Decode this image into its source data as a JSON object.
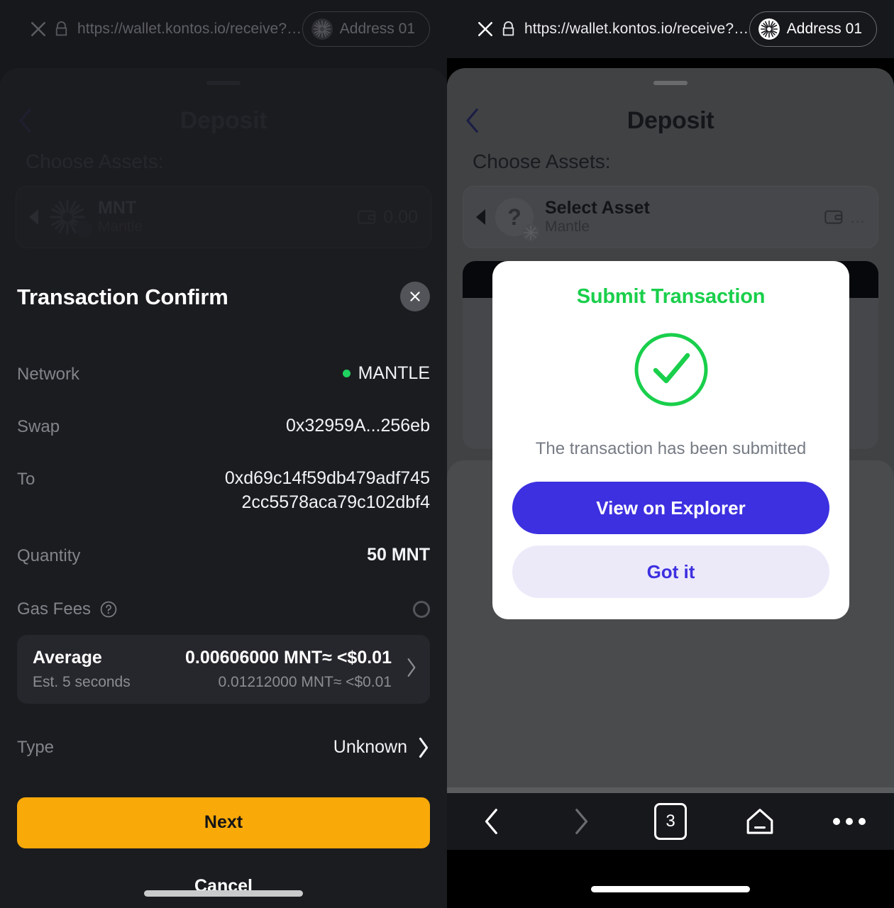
{
  "browser": {
    "url": "https://wallet.kontos.io/receive?cha...",
    "address_pill": "Address 01",
    "close_icon": "close-icon",
    "lock_icon": "lock-icon"
  },
  "left_panel": {
    "background_page": {
      "title": "Deposit",
      "choose_assets_label": "Choose Assets:",
      "asset": {
        "symbol": "MNT",
        "chain": "Mantle",
        "balance": "0.00"
      }
    },
    "confirm_sheet": {
      "title": "Transaction Confirm",
      "close_icon": "close-icon",
      "rows": [
        {
          "key": "Network",
          "value": "MANTLE",
          "status_color": "#1fd360"
        },
        {
          "key": "Swap",
          "value": "0x32959A...256eb"
        },
        {
          "key": "To",
          "value": "0xd69c14f59db479adf7452cc5578aca79c102dbf4"
        },
        {
          "key": "Quantity",
          "value": "50 MNT"
        }
      ],
      "gas": {
        "label": "Gas Fees",
        "help_icon": "question-mark-icon",
        "loading_icon": "spinner-icon",
        "tier": "Average",
        "amount": "0.00606000 MNT≈ <$0.01",
        "eta": "Est. 5 seconds",
        "amount_alt": "0.01212000 MNT≈ <$0.01",
        "chevron_icon": "chevron-right-icon"
      },
      "type_row": {
        "key": "Type",
        "value": "Unknown",
        "chevron_icon": "chevron-right-icon"
      },
      "next_label": "Next",
      "cancel_label": "Cancel",
      "next_color": "#f9a908"
    }
  },
  "right_panel": {
    "background_page": {
      "title": "Deposit",
      "choose_assets_label": "Choose Assets:",
      "asset": {
        "symbol": "Select Asset",
        "chain": "Mantle",
        "balance": "...",
        "avatar_glyph": "?"
      }
    },
    "submit_modal": {
      "title": "Submit Transaction",
      "title_color": "#19cf4b",
      "success_icon": "check-circle-icon",
      "message": "The transaction has been submitted",
      "primary_label": "View on Explorer",
      "primary_color": "#3d30e0",
      "secondary_label": "Got it",
      "secondary_color": "#eceaf9"
    },
    "navbar": {
      "back_icon": "chevron-left-icon",
      "forward_icon": "chevron-right-icon",
      "tab_count": "3",
      "home_icon": "home-icon",
      "menu_icon": "more-horizontal-icon"
    }
  }
}
